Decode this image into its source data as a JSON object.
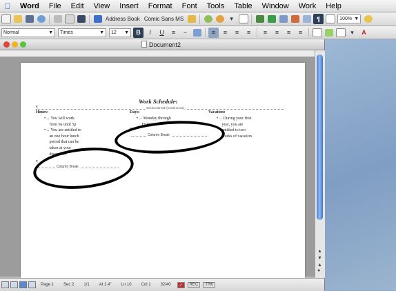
{
  "menubar": {
    "items": [
      "Word",
      "File",
      "Edit",
      "View",
      "Insert",
      "Format",
      "Font",
      "Tools",
      "Table",
      "Window",
      "Work",
      "Help"
    ]
  },
  "toolbar": {
    "address_book_label": "Address Book",
    "font_name_preview": "Comic Sans MS",
    "zoom_value": "100%"
  },
  "formatting": {
    "style_value": "Normal",
    "font_value": "Times",
    "size_value": "12",
    "bold_label": "B",
    "italic_label": "I",
    "underline_label": "U"
  },
  "window": {
    "title": "Document2"
  },
  "document": {
    "title": "Work Schedule",
    "pilcrow": "¶",
    "section_break_label": "Section Break (Continuous)",
    "columns": [
      {
        "heading": "Hours:",
        "lines": [
          "You will work",
          "from 9a until 5p",
          "You are entitled to",
          "an one hour lunch",
          "period that can be",
          "taken at your",
          "discretion"
        ]
      },
      {
        "heading": "Days:",
        "lines": [
          "Monday through",
          "Friday"
        ]
      },
      {
        "heading": "Vacation:",
        "lines": [
          "During your first",
          "year, you are",
          "entitled to two",
          "weeks of vacation"
        ]
      }
    ],
    "column_break_label": "Column Break"
  },
  "statusbar": {
    "page": "Page 1",
    "section": "Sec 2",
    "page_of": "1/1",
    "at": "At 1.4\"",
    "line": "Ln 10",
    "col": "Col 1",
    "words": "32/40",
    "rec": "REC",
    "trk": "TRK"
  },
  "colors": {
    "annotation": "#000000",
    "scroll_thumb": "#4e83d6",
    "apple_logo": "#2a62c9"
  }
}
